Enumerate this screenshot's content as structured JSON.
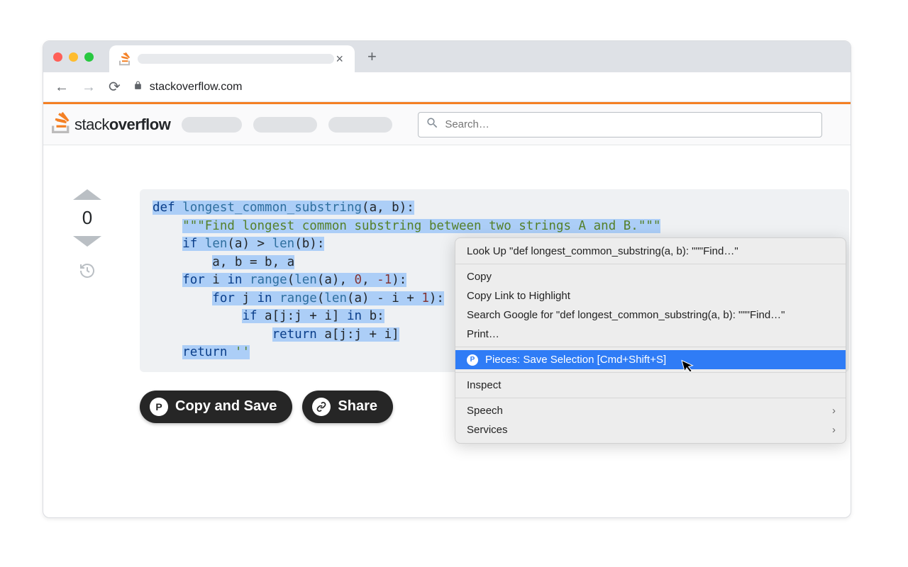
{
  "browser": {
    "url": "stackoverflow.com",
    "tab_close": "×",
    "new_tab": "+"
  },
  "so_header": {
    "logo_light": "stack",
    "logo_bold": "overflow",
    "search_placeholder": "Search…"
  },
  "vote": {
    "count": "0"
  },
  "code": {
    "l1_kw": "def",
    "l1_fn": "longest_common_substring",
    "l1_rest": "(a, b):",
    "l2_str": "\"\"\"Find longest common substring between two strings A and B.\"\"\"",
    "l3_kw": "if",
    "l3_a": "len",
    "l3_b": "(a) > ",
    "l3_c": "len",
    "l3_d": "(b):",
    "l4": "a, b = b, a",
    "l5_kw": "for",
    "l5_a": " i ",
    "l5_in": "in",
    "l5_b": " ",
    "l5_rng": "range",
    "l5_c": "(",
    "l5_len": "len",
    "l5_d": "(a), ",
    "l5_n0": "0",
    "l5_e": ", ",
    "l5_n1": "-1",
    "l5_f": "):",
    "l6_kw": "for",
    "l6_a": " j ",
    "l6_in": "in",
    "l6_b": " ",
    "l6_rng": "range",
    "l6_c": "(",
    "l6_len": "len",
    "l6_d": "(a) - i + ",
    "l6_n": "1",
    "l6_e": "):",
    "l7_kw": "if",
    "l7_a": " a[j:j + i] ",
    "l7_in": "in",
    "l7_b": " b:",
    "l8_kw": "return",
    "l8_a": " a[j:j + i]",
    "l9_kw": "return",
    "l9_str": "''"
  },
  "buttons": {
    "copy_save": "Copy and Save",
    "share": "Share"
  },
  "context_menu": {
    "lookup": "Look Up \"def longest_common_substring(a, b):    \"\"\"Find…\"",
    "copy": "Copy",
    "copy_link": "Copy Link to Highlight",
    "search_google": "Search Google for \"def longest_common_substring(a, b):    \"\"\"Find…\"",
    "print": "Print…",
    "pieces": "Pieces: Save Selection [Cmd+Shift+S]",
    "inspect": "Inspect",
    "speech": "Speech",
    "services": "Services"
  }
}
